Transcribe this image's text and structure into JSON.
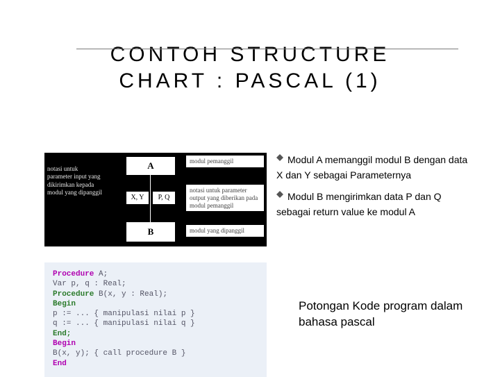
{
  "title_l1": "CONTOH STRUCTURE",
  "title_l2": "CHART : PASCAL (1)",
  "diagram": {
    "left_note": "notasi untuk parameter input yang dikirimkan kepada modul yang dipanggil",
    "box_a": "A",
    "box_b": "B",
    "mid_l": "X, Y",
    "mid_r": "P, Q",
    "note_r1": "modul pemanggil",
    "note_r2": "notasi untuk parameter output yang diberikan pada modul pemanggil",
    "note_r3": "modul yang dipanggil"
  },
  "bullets": {
    "b1": "Modul A memanggil modul B dengan data X dan Y sebagai Parameternya",
    "b2": "Modul B mengirimkan data P dan Q sebagai return value ke modul A"
  },
  "code": {
    "l1a": "Procedure",
    "l1b": " A;",
    "l2": "  Var p, q : Real;",
    "l3a": "  Procedure",
    "l3b": " B(x, y : Real);",
    "l4": "  Begin",
    "l5": "    p := ... { manipulasi nilai p }",
    "l6": "    q := ... { manipulasi nilai q }",
    "l7": "  End;",
    "l8": "Begin",
    "l9": "  B(x, y); { call procedure B }",
    "l10": "End"
  },
  "caption": "Potongan Kode program dalam bahasa pascal"
}
